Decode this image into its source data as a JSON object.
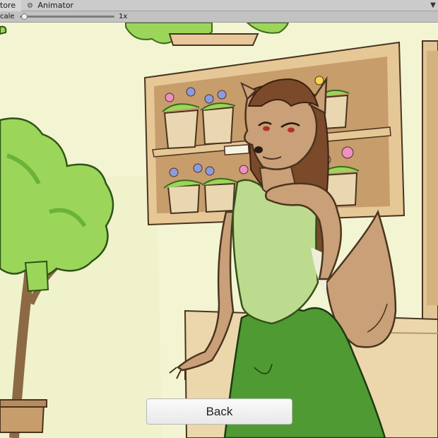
{
  "editor": {
    "tabs": [
      {
        "label": "tore",
        "active": true
      },
      {
        "label": "Animator",
        "active": false,
        "icon": "animator-icon"
      }
    ],
    "toolbar": {
      "scale_label": "cale",
      "scale_value": "1x",
      "scale_level": 0.05
    }
  },
  "game": {
    "back_button": {
      "label": "Back"
    }
  },
  "colors": {
    "wall": "#f3f5d2",
    "shelf": "#d9b98f",
    "leaf": "#9bd65a",
    "dress_top": "#bcdb8e",
    "dress_skirt": "#4f9a33",
    "fur": "#c9a077",
    "hair": "#7a4a2a"
  }
}
